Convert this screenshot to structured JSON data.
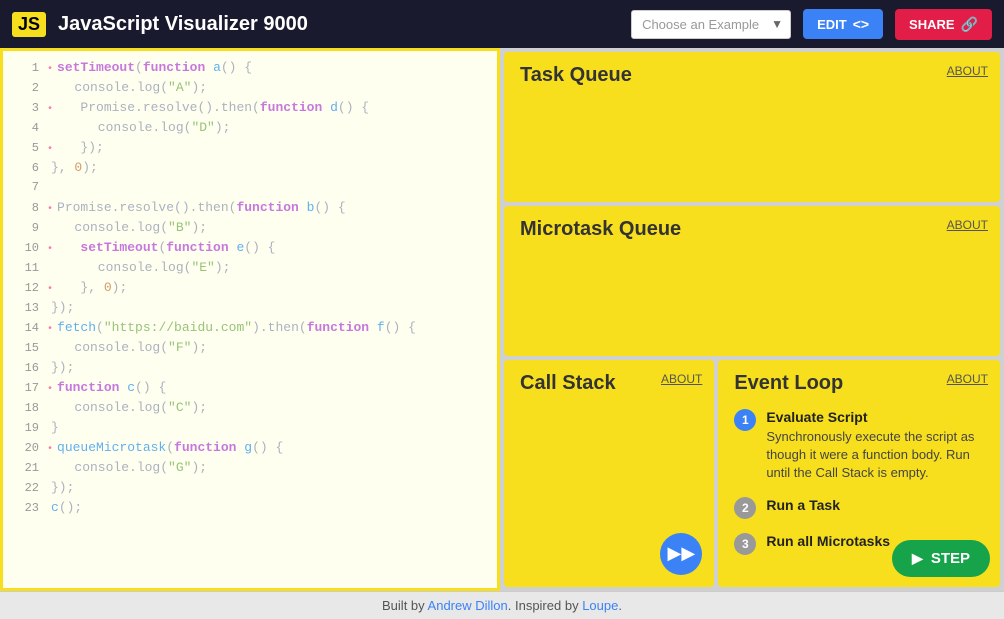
{
  "header": {
    "logo": "JS",
    "title": "JavaScript Visualizer 9000",
    "select_placeholder": "Choose an Example",
    "edit_label": "EDIT",
    "share_label": "SHARE"
  },
  "code": {
    "lines": [
      {
        "num": "1",
        "dot": true,
        "text": "setTimeout(function a() {",
        "tokens": [
          {
            "t": "kw",
            "v": "setTimeout"
          },
          {
            "t": "plain",
            "v": "("
          },
          {
            "t": "kw",
            "v": "function"
          },
          {
            "t": "fn",
            "v": " a"
          },
          {
            "t": "plain",
            "v": "() {"
          }
        ]
      },
      {
        "num": "2",
        "dot": false,
        "text": "   console.log(\"A\");",
        "tokens": [
          {
            "t": "plain",
            "v": "   console.log("
          },
          {
            "t": "str",
            "v": "\"A\""
          },
          {
            "t": "plain",
            "v": ");"
          }
        ]
      },
      {
        "num": "3",
        "dot": true,
        "text": "   Promise.resolve().then(function d() {",
        "tokens": [
          {
            "t": "plain",
            "v": "   Promise.resolve().then("
          },
          {
            "t": "kw",
            "v": "function"
          },
          {
            "t": "fn",
            "v": " d"
          },
          {
            "t": "plain",
            "v": "() {"
          }
        ]
      },
      {
        "num": "4",
        "dot": false,
        "text": "      console.log(\"D\");",
        "tokens": [
          {
            "t": "plain",
            "v": "      console.log("
          },
          {
            "t": "str",
            "v": "\"D\""
          },
          {
            "t": "plain",
            "v": ");"
          }
        ]
      },
      {
        "num": "5",
        "dot": true,
        "text": "   });",
        "tokens": [
          {
            "t": "plain",
            "v": "   });"
          }
        ]
      },
      {
        "num": "6",
        "dot": false,
        "text": "}, 0);",
        "tokens": [
          {
            "t": "plain",
            "v": "}, "
          },
          {
            "t": "num",
            "v": "0"
          },
          {
            "t": "plain",
            "v": ");"
          }
        ]
      },
      {
        "num": "7",
        "dot": false,
        "text": "",
        "tokens": []
      },
      {
        "num": "8",
        "dot": true,
        "text": "Promise.resolve().then(function b() {",
        "tokens": [
          {
            "t": "plain",
            "v": "Promise.resolve().then("
          },
          {
            "t": "kw",
            "v": "function"
          },
          {
            "t": "fn",
            "v": " b"
          },
          {
            "t": "plain",
            "v": "() {"
          }
        ]
      },
      {
        "num": "9",
        "dot": false,
        "text": "   console.log(\"B\");",
        "tokens": [
          {
            "t": "plain",
            "v": "   console.log("
          },
          {
            "t": "str",
            "v": "\"B\""
          },
          {
            "t": "plain",
            "v": ");"
          }
        ]
      },
      {
        "num": "10",
        "dot": true,
        "text": "   setTimeout(function e() {",
        "tokens": [
          {
            "t": "plain",
            "v": "   "
          },
          {
            "t": "kw",
            "v": "setTimeout"
          },
          {
            "t": "plain",
            "v": "("
          },
          {
            "t": "kw",
            "v": "function"
          },
          {
            "t": "fn",
            "v": " e"
          },
          {
            "t": "plain",
            "v": "() {"
          }
        ]
      },
      {
        "num": "11",
        "dot": false,
        "text": "      console.log(\"E\");",
        "tokens": [
          {
            "t": "plain",
            "v": "      console.log("
          },
          {
            "t": "str",
            "v": "\"E\""
          },
          {
            "t": "plain",
            "v": ");"
          }
        ]
      },
      {
        "num": "12",
        "dot": true,
        "text": "   }, 0);",
        "tokens": [
          {
            "t": "plain",
            "v": "   }, "
          },
          {
            "t": "num",
            "v": "0"
          },
          {
            "t": "plain",
            "v": ");"
          }
        ]
      },
      {
        "num": "13",
        "dot": false,
        "text": "});",
        "tokens": [
          {
            "t": "plain",
            "v": "});"
          }
        ]
      },
      {
        "num": "14",
        "dot": true,
        "text": "fetch(\"https://baidu.com\").then(function f() {",
        "tokens": [
          {
            "t": "fn",
            "v": "fetch"
          },
          {
            "t": "plain",
            "v": "("
          },
          {
            "t": "str",
            "v": "\"https://baidu.com\""
          },
          {
            "t": "plain",
            "v": ").then("
          },
          {
            "t": "kw",
            "v": "function"
          },
          {
            "t": "fn",
            "v": " f"
          },
          {
            "t": "plain",
            "v": "() {"
          }
        ]
      },
      {
        "num": "15",
        "dot": false,
        "text": "   console.log(\"F\");",
        "tokens": [
          {
            "t": "plain",
            "v": "   console.log("
          },
          {
            "t": "str",
            "v": "\"F\""
          },
          {
            "t": "plain",
            "v": ");"
          }
        ]
      },
      {
        "num": "16",
        "dot": false,
        "text": "});",
        "tokens": [
          {
            "t": "plain",
            "v": "});"
          }
        ]
      },
      {
        "num": "17",
        "dot": true,
        "text": "function c() {",
        "tokens": [
          {
            "t": "kw",
            "v": "function"
          },
          {
            "t": "fn",
            "v": " c"
          },
          {
            "t": "plain",
            "v": "() {"
          }
        ]
      },
      {
        "num": "18",
        "dot": false,
        "text": "   console.log(\"C\");",
        "tokens": [
          {
            "t": "plain",
            "v": "   console.log("
          },
          {
            "t": "str",
            "v": "\"C\""
          },
          {
            "t": "plain",
            "v": ");"
          }
        ]
      },
      {
        "num": "19",
        "dot": false,
        "text": "}",
        "tokens": [
          {
            "t": "plain",
            "v": "}"
          }
        ]
      },
      {
        "num": "20",
        "dot": true,
        "text": "queueMicrotask(function g() {",
        "tokens": [
          {
            "t": "fn",
            "v": "queueMicrotask"
          },
          {
            "t": "plain",
            "v": "("
          },
          {
            "t": "kw",
            "v": "function"
          },
          {
            "t": "fn",
            "v": " g"
          },
          {
            "t": "plain",
            "v": "() {"
          }
        ]
      },
      {
        "num": "21",
        "dot": false,
        "text": "   console.log(\"G\");",
        "tokens": [
          {
            "t": "plain",
            "v": "   console.log("
          },
          {
            "t": "str",
            "v": "\"G\""
          },
          {
            "t": "plain",
            "v": ");"
          }
        ]
      },
      {
        "num": "22",
        "dot": false,
        "text": "});",
        "tokens": [
          {
            "t": "plain",
            "v": "});"
          }
        ]
      },
      {
        "num": "23",
        "dot": false,
        "text": "c();",
        "tokens": [
          {
            "t": "fn",
            "v": "c"
          },
          {
            "t": "plain",
            "v": "();"
          }
        ]
      }
    ]
  },
  "footer": {
    "text_prefix": "Built by ",
    "author": "Andrew Dillon",
    "author_url": "#",
    "text_middle": ". Inspired by ",
    "inspiration": "Loupe",
    "inspiration_url": "#",
    "text_suffix": "."
  },
  "panels": {
    "task_queue": {
      "title": "Task Queue",
      "about": "ABOUT"
    },
    "microtask_queue": {
      "title": "Microtask Queue",
      "about": "ABOUT"
    },
    "call_stack": {
      "title": "Call Stack",
      "about": "ABOUT"
    },
    "event_loop": {
      "title": "Event Loop",
      "about": "ABOUT",
      "items": [
        {
          "num": "1",
          "active": true,
          "label": "Evaluate Script",
          "desc": "Synchronously execute the script as though it were a function body. Run until the Call Stack is empty."
        },
        {
          "num": "2",
          "active": false,
          "label": "Run a Task",
          "desc": ""
        },
        {
          "num": "3",
          "active": false,
          "label": "Run all Microtasks",
          "desc": ""
        }
      ],
      "next_btn": "▶▶",
      "step_btn": "STEP"
    }
  }
}
